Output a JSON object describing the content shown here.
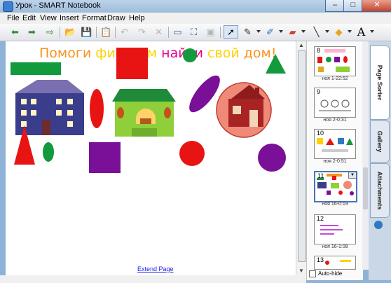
{
  "window": {
    "title": "Урок - SMART Notebook",
    "minimize": "–",
    "maximize": "□",
    "close": "✕"
  },
  "menu": [
    "File",
    "Edit",
    "View",
    "Insert",
    "Format",
    "Draw",
    "Help"
  ],
  "toolbar_icons": [
    "back-icon",
    "forward-icon",
    "add-page-icon",
    "open-icon",
    "save-icon",
    "paste-icon",
    "undo-icon",
    "redo-icon",
    "delete-icon",
    "screen-shade-icon",
    "full-screen-icon",
    "camera-icon",
    "select-icon",
    "pen-icon",
    "creative-pen-icon",
    "eraser-icon",
    "line-icon",
    "shape-icon",
    "text-icon"
  ],
  "canvas": {
    "title_words": [
      {
        "text": "Помоги",
        "color": "#f7931e"
      },
      {
        "text": "фигурам",
        "color": "#ffd200"
      },
      {
        "text": "найти",
        "color": "#ec008c"
      },
      {
        "text": "свой",
        "color": "#ffd200"
      },
      {
        "text": "дом!",
        "color": "#f7931e"
      }
    ],
    "extend_link": "Extend Page",
    "shape_colors": {
      "red": "#e81414",
      "green": "#129a3c",
      "purple": "#7a0f98",
      "blue_house": "#3a3d8c",
      "green_house": "#8fcf3a",
      "red_house": "#a82424"
    }
  },
  "sorter": {
    "thumbnails": [
      {
        "number": "8",
        "label": "ноя 1-22:52"
      },
      {
        "number": "9",
        "label": "ноя 2-0:31"
      },
      {
        "number": "10",
        "label": "ноя 2-0:51"
      },
      {
        "number": "11",
        "label": "ноя 16-0:19"
      },
      {
        "number": "12",
        "label": "ноя 16-1:08"
      },
      {
        "number": "13",
        "label": ""
      }
    ],
    "auto_hide": "Auto-hide"
  },
  "tabs": [
    "Page Sorter",
    "Gallery",
    "Attachments"
  ]
}
